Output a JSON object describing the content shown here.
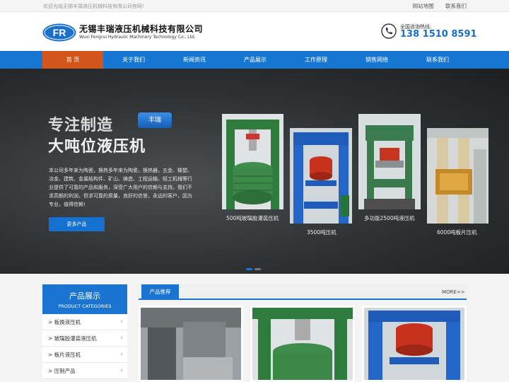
{
  "topbar": {
    "welcome": "欢迎光临无锡丰瑞液压机械科技有限公司官网!",
    "links": [
      "网站地图",
      "联系我们"
    ]
  },
  "header": {
    "logo_text": "FR",
    "company_cn": "无锡丰瑞液压机械科技有限公司",
    "company_en": "Wuxi Fengrui Hydraulic Machinery Technology Co., Ltd.",
    "hotline_label": "全国咨询热线:",
    "hotline_number": "138 1510 8591"
  },
  "nav": {
    "items": [
      "首 页",
      "关于我们",
      "新闻资讯",
      "产品展示",
      "工作原理",
      "销售网络",
      "联系我们"
    ],
    "active_index": 0,
    "active_color": "#d4551a",
    "bar_color": "#1677d2"
  },
  "banner": {
    "slogan_line1": "专注制造",
    "slogan_line2": "大吨位液压机",
    "badge": "丰瑞",
    "intro": "本公司多年来为陶瓷，换热多年来为陶瓷，换热器，五金、橡塑、冶金、建筑、金属结构件、矿山、铸造、工程运输、轻工机械等行业提供了可靠的产品和服务，深受广大用户的信赖与支持。我们不求高额的利润，但求可靠的质量，良好的信誉，永远的客户，因为专业，值得信赖!",
    "more_button": "更多产品",
    "products": [
      {
        "caption": "500吨玻璃胶灌装压机"
      },
      {
        "caption": "3500吨压机"
      },
      {
        "caption": "多功能2500吨液压机"
      },
      {
        "caption": "6000吨板片压机"
      }
    ],
    "slide_dots": 2,
    "active_slide": 0
  },
  "sidebar": {
    "title": "产品展示",
    "subtitle": "PRODUCT CATEGORIES",
    "items": [
      "> 板换液压机",
      "> 玻璃胶灌装液压机",
      "> 板片液压机",
      "> 压制产品"
    ]
  },
  "recommend": {
    "tab": "产品推荐",
    "more": "MORE>>"
  }
}
